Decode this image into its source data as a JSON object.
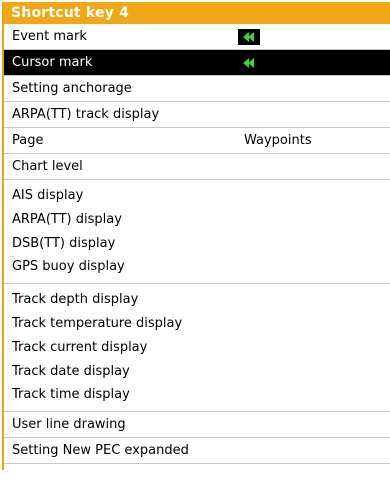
{
  "menu": {
    "title": "Shortcut key 4",
    "items": [
      {
        "label": "Event mark",
        "icon": "green-mark-icon"
      },
      {
        "label": "Cursor mark",
        "icon": "green-mark-icon",
        "selected": true
      },
      {
        "label": "Setting anchorage"
      },
      {
        "label": "ARPA(TT) track display"
      },
      {
        "label": "Page",
        "value": "Waypoints"
      },
      {
        "label": "Chart level"
      }
    ],
    "target_display_group": [
      "AIS display",
      "ARPA(TT) display",
      "DSB(TT) display",
      "GPS buoy display"
    ],
    "track_display_group": [
      "Track depth display",
      "Track temperature display",
      "Track current display",
      "Track date display",
      "Track time display"
    ],
    "user_line": "User line drawing",
    "pec": "Setting New PEC expanded"
  },
  "colors": {
    "title_bg": "#f0a818",
    "mark_green": "#3cd23c",
    "selected_bg": "#000000"
  }
}
